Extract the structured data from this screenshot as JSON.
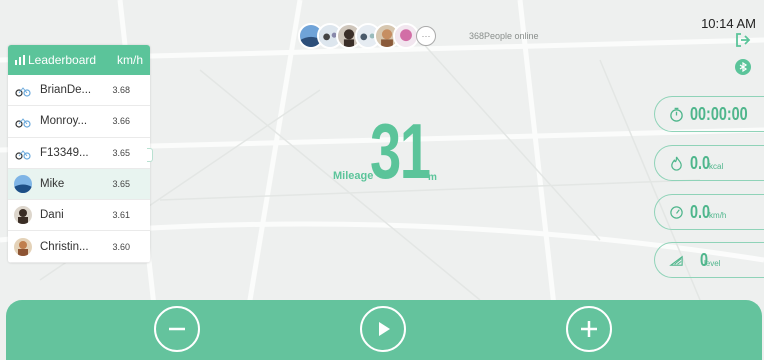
{
  "header": {
    "online_count": "368People online",
    "time": "10:14 AM",
    "more_label": "···"
  },
  "leaderboard": {
    "title": "Leaderboard",
    "unit": "km/h",
    "rows": [
      {
        "name": "BrianDe...",
        "speed": "3.68",
        "avatar": "bike-avatar"
      },
      {
        "name": "Monroy...",
        "speed": "3.66",
        "avatar": "bike-avatar"
      },
      {
        "name": "F13349...",
        "speed": "3.65",
        "avatar": "bike-avatar"
      },
      {
        "name": "Mike",
        "speed": "3.65",
        "avatar": "landscape-avatar",
        "active": true
      },
      {
        "name": "Dani",
        "speed": "3.61",
        "avatar": "person-avatar"
      },
      {
        "name": "Christin...",
        "speed": "3.60",
        "avatar": "person-avatar"
      }
    ]
  },
  "mileage": {
    "label": "Mileage",
    "value": "31",
    "unit": "m"
  },
  "stats": {
    "time": {
      "value": "00:00:00",
      "icon": "stopwatch-icon"
    },
    "calories": {
      "value": "0.0",
      "unit": "kcal",
      "icon": "flame-icon"
    },
    "speed": {
      "value": "0.0",
      "unit": "km/h",
      "icon": "speedometer-icon"
    },
    "level": {
      "value": "0",
      "unit": "level",
      "icon": "incline-icon"
    }
  },
  "colors": {
    "accent": "#5bc49a",
    "bottom_bar": "#64c39d"
  }
}
